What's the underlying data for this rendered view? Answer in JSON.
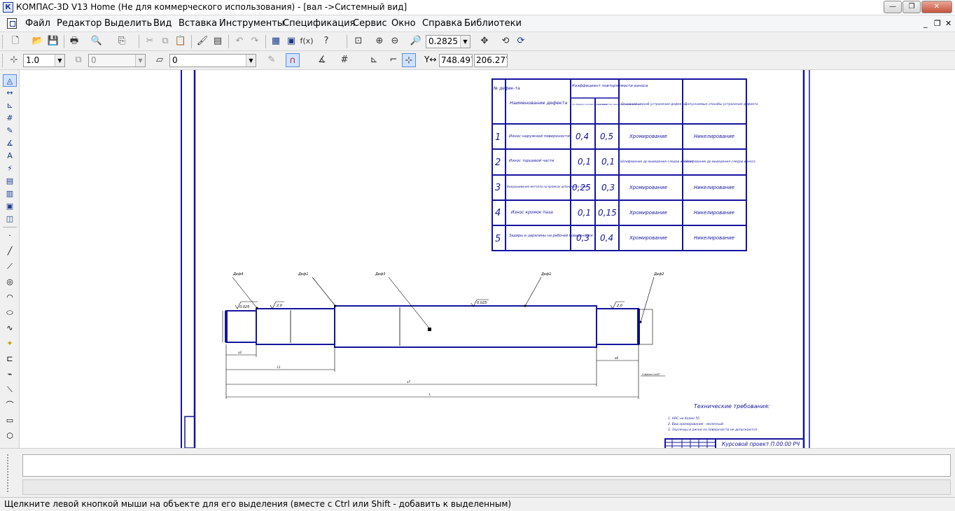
{
  "window": {
    "title": "КОМПАС-3D V13 Home (Не для коммерческого использования) - [вал ->Системный вид]",
    "icon": "kompas-app-icon",
    "buttons": {
      "minimize": "—",
      "maximize": "❐",
      "close": "✕"
    }
  },
  "menu": {
    "items": [
      "Файл",
      "Редактор",
      "Выделить",
      "Вид",
      "Вставка",
      "Инструменты",
      "Спецификация",
      "Сервис",
      "Окно",
      "Справка",
      "Библиотеки"
    ],
    "mdi_buttons": [
      "_",
      "❐",
      "✕"
    ]
  },
  "toolbar1": {
    "icons": [
      "new-document-icon",
      "open-folder-icon",
      "save-icon",
      "print-icon",
      "preview-icon",
      "page-setup-icon",
      "cut-icon",
      "copy-icon",
      "paste-icon",
      "properties-brush-icon",
      "manager-icon",
      "undo-icon",
      "redo-icon",
      "layers-icon",
      "variables-icon",
      "formula-icon",
      "help-pointer-icon",
      "zoom-window-icon",
      "zoom-in-icon",
      "zoom-out-icon",
      "zoom-scale-icon",
      "pan-icon",
      "refresh-icon",
      "regenerate-icon"
    ],
    "zoom_value": "0.2825",
    "formula_glyph": "f(x)"
  },
  "toolbar2": {
    "step_value": "1.0",
    "layer_disabled_value": "0",
    "layer_value": "0",
    "coord_x": "748.497",
    "coord_y": "206.277",
    "coord_label": "Y↔"
  },
  "drawing": {
    "table": {
      "headers": [
        "№ дефек-та",
        "Наименование дефекта",
        "Коэффициент повторяемости износа",
        "Основной способ устранения дефекта",
        "Допускаемые способы устранения дефекта"
      ],
      "subheaders": [
        "по общему количеству деталей",
        "по количеству ремонтируемых деталей"
      ],
      "rows": [
        {
          "n": "1",
          "name": "Износ наружной поверхности",
          "k1": "0,4",
          "k2": "0,5",
          "main": "Хромирование",
          "alt": "Никелирование"
        },
        {
          "n": "2",
          "name": "Износ торцевой части",
          "k1": "0,1",
          "k2": "0,1",
          "main": "Шлифование до выведения следов износа",
          "alt": "Шлифование до выведения следов износа"
        },
        {
          "n": "3",
          "name": "Выкрашивание металла на кромках шпоночного паза",
          "k1": "0,25",
          "k2": "0,3",
          "main": "Хромирование",
          "alt": "Никелирование"
        },
        {
          "n": "4",
          "name": "Износ кромок паза",
          "k1": "0,1",
          "k2": "0,15",
          "main": "Хромирование",
          "alt": "Никелирование"
        },
        {
          "n": "5",
          "name": "Задиры и царапины на рабочей поверхности",
          "k1": "0,3",
          "k2": "0,4",
          "main": "Хромирование",
          "alt": "Никелирование"
        }
      ]
    },
    "callouts": [
      "Деф4",
      "Деф1",
      "Деф3",
      "Деф1",
      "Деф2"
    ],
    "roughness": [
      "0.025",
      "2.0",
      "0.025",
      "2.0"
    ],
    "dims": [
      "a2",
      "L1",
      "a7",
      "L",
      "a6"
    ],
    "chamfer": "2 фаски 1x45°",
    "tech_req": {
      "title": "Технические требования:",
      "lines": [
        "1. HRC не более 55.",
        "2. Вид хромирования - молочный.",
        "3. Заусенцы и риски на поверхности не допускаются."
      ]
    },
    "stamp": "Курсовой проект П.00.00 РЧ"
  },
  "status": {
    "hint": "Щелкните левой кнопкой мыши на объекте для его выделения (вместе с Ctrl или Shift - добавить к выделенным)"
  },
  "colors": {
    "drawing_blue": "#1414a0",
    "frame": "#1414a0",
    "dim_line": "#000000"
  }
}
